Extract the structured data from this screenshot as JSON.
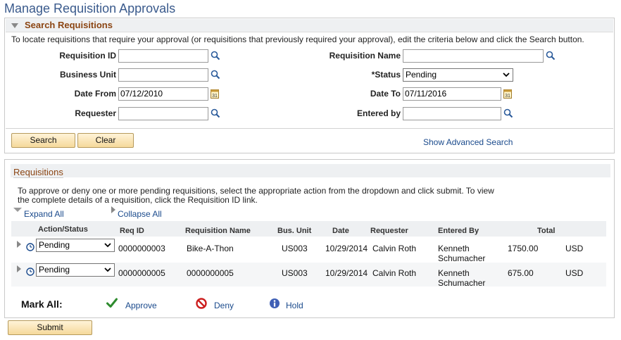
{
  "page": {
    "title": "Manage Requisition Approvals"
  },
  "search": {
    "title": "Search Requisitions",
    "instructions": "To locate requisitions that require your approval (or requisitions that previously required your approval), edit the criteria below and click the Search button.",
    "fields": {
      "requisition_id": {
        "label": "Requisition ID",
        "value": ""
      },
      "requisition_name": {
        "label": "Requisition Name",
        "value": ""
      },
      "business_unit": {
        "label": "Business Unit",
        "value": ""
      },
      "status": {
        "label": "*Status",
        "value": "Pending"
      },
      "date_from": {
        "label": "Date From",
        "value": "07/12/2010"
      },
      "date_to": {
        "label": "Date To",
        "value": "07/11/2016"
      },
      "requester": {
        "label": "Requester",
        "value": ""
      },
      "entered_by": {
        "label": "Entered by",
        "value": ""
      }
    },
    "search_button": "Search",
    "clear_button": "Clear",
    "advanced_link": "Show Advanced Search"
  },
  "requisitions": {
    "title": "Requisitions",
    "instructions_line1": "To approve or deny one or more pending requisitions, select the appropriate action from the dropdown and click submit. To view",
    "instructions_line2": "the complete details of a requisition, click the Requisition ID link.",
    "expand_all": "Expand All",
    "collapse_all": "Collapse All",
    "columns": {
      "action_status": "Action/Status",
      "req_id": "Req ID",
      "requisition_name": "Requisition Name",
      "bus_unit": "Bus. Unit",
      "date": "Date",
      "requester": "Requester",
      "entered_by": "Entered By",
      "total": "Total"
    },
    "rows": [
      {
        "action": "Pending",
        "req_id": "0000000003",
        "name": "Bike-A-Thon",
        "bus_unit": "US003",
        "date": "10/29/2014",
        "requester": "Calvin Roth",
        "entered_by_1": "Kenneth",
        "entered_by_2": "Schumacher",
        "total": "1750.00",
        "currency": "USD"
      },
      {
        "action": "Pending",
        "req_id": "0000000005",
        "name": "0000000005",
        "bus_unit": "US003",
        "date": "10/29/2014",
        "requester": "Calvin Roth",
        "entered_by_1": "Kenneth",
        "entered_by_2": "Schumacher",
        "total": "675.00",
        "currency": "USD"
      }
    ],
    "mark_all": {
      "label": "Mark All:",
      "approve": "Approve",
      "deny": "Deny",
      "hold": "Hold"
    }
  },
  "submit_button": "Submit"
}
